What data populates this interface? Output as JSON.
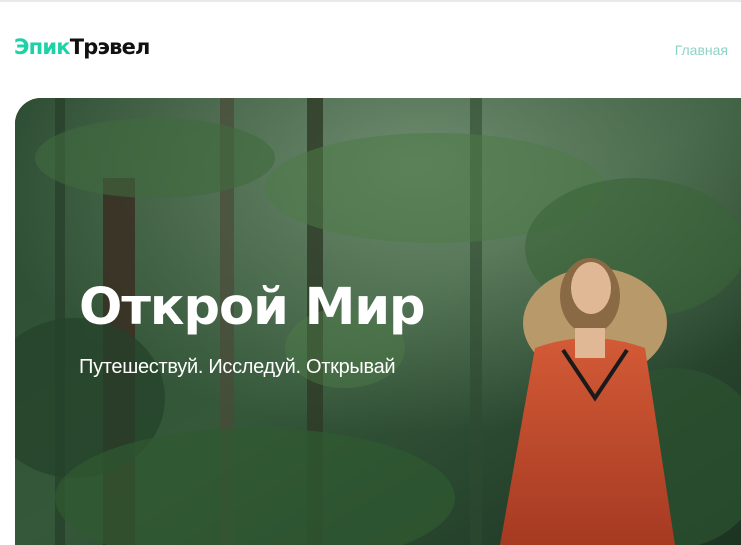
{
  "header": {
    "logo_part1": "Эпик",
    "logo_part2": "Трэвел",
    "nav_home": "Главная"
  },
  "hero": {
    "title": "Открой Мир",
    "subtitle": "Путешествуй. Исследуй. Открывай"
  },
  "colors": {
    "brand_accent": "#1fd1a6",
    "logo_dark": "#111111",
    "nav_link": "#8fd3c6"
  }
}
